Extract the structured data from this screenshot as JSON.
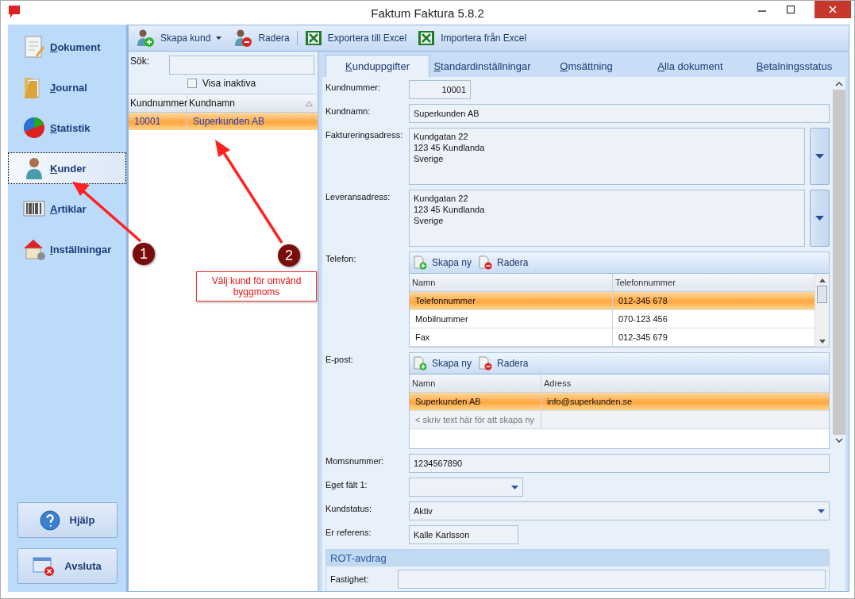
{
  "window": {
    "title": "Faktum Faktura 5.8.2"
  },
  "nav": {
    "items": [
      {
        "label": "Dokument",
        "kind": "document",
        "selected": false
      },
      {
        "label": "Journal",
        "kind": "folder",
        "selected": false
      },
      {
        "label": "Statistik",
        "kind": "chart",
        "selected": false
      },
      {
        "label": "Kunder",
        "kind": "person",
        "selected": true
      },
      {
        "label": "Artiklar",
        "kind": "barcode",
        "selected": false
      },
      {
        "label": "Inställningar",
        "kind": "house",
        "selected": false
      }
    ],
    "buttons": [
      {
        "label": "Hjälp",
        "kind": "help"
      },
      {
        "label": "Avsluta",
        "kind": "exit"
      }
    ]
  },
  "toolbar": [
    {
      "label": "Skapa kund",
      "kind": "add-person",
      "dropdown": true
    },
    {
      "label": "Radera",
      "kind": "delete-person",
      "dropdown": false
    },
    {
      "label": "Exportera till Excel",
      "kind": "excel",
      "dropdown": false
    },
    {
      "label": "Importera från Excel",
      "kind": "excel",
      "dropdown": false
    }
  ],
  "search": {
    "label": "Sök:",
    "show_inactive": {
      "label": "Visa inaktiva",
      "checked": false
    }
  },
  "customer_table": {
    "columns": [
      "Kundnummer",
      "Kundnamn"
    ],
    "rows": [
      {
        "cells": [
          "10001",
          "Superkunden AB"
        ],
        "selected": true
      }
    ]
  },
  "tabs": [
    {
      "label": "Kunduppgifter",
      "selected": true
    },
    {
      "label": "Standardinställningar",
      "selected": false
    },
    {
      "label": "Omsättning",
      "selected": false
    },
    {
      "label": "Alla dokument",
      "selected": false
    },
    {
      "label": "Betalningsstatus",
      "selected": false
    }
  ],
  "form": [
    {
      "kind": "short",
      "label": "Kundnummer:",
      "value": "10001"
    },
    {
      "kind": "text",
      "label": "Kundnamn:",
      "value": "Superkunden AB"
    },
    {
      "kind": "address",
      "label": "Faktureringsadress:",
      "lines": [
        "Kundgatan 22",
        "123 45 Kundlanda",
        "Sverige"
      ]
    },
    {
      "kind": "address",
      "label": "Leveransadress:",
      "lines": [
        "Kundgatan 22",
        "123 45 Kundlanda",
        "Sverige"
      ]
    },
    {
      "kind": "grid",
      "label": "Telefon:",
      "actions": [
        "Skapa ny",
        "Radera"
      ],
      "columns": [
        "Namn",
        "Telefonnummer"
      ],
      "rows": [
        {
          "cells": [
            "Telefonnummer",
            "012-345 678"
          ],
          "selected": true
        },
        {
          "cells": [
            "Mobilnummer",
            "070-123 456"
          ],
          "selected": false
        },
        {
          "cells": [
            "Fax",
            "012-345 679"
          ],
          "selected": false
        }
      ]
    },
    {
      "kind": "grid",
      "label": "E-post:",
      "actions": [
        "Skapa ny",
        "Radera"
      ],
      "columns": [
        "Namn",
        "Adress"
      ],
      "rows": [
        {
          "cells": [
            "Superkunden AB",
            "info@superkunden.se"
          ],
          "selected": true
        }
      ],
      "new_row_placeholder": "< skriv text här för att skapa ny"
    },
    {
      "kind": "text",
      "label": "Momsnummer:",
      "value": "1234567890"
    },
    {
      "kind": "combo-short",
      "label": "Eget fält 1:"
    },
    {
      "kind": "combo",
      "label": "Kundstatus:",
      "value": "Aktiv"
    },
    {
      "kind": "medium",
      "label": "Er referens:",
      "value": "Kalle Karlsson"
    }
  ],
  "rot_section": {
    "title": "ROT-avdrag",
    "fields": [
      {
        "label": "Fastighet:"
      }
    ]
  },
  "annotations": {
    "badges": [
      "1",
      "2"
    ],
    "callout": "Välj kund för omvänd byggmoms"
  }
}
